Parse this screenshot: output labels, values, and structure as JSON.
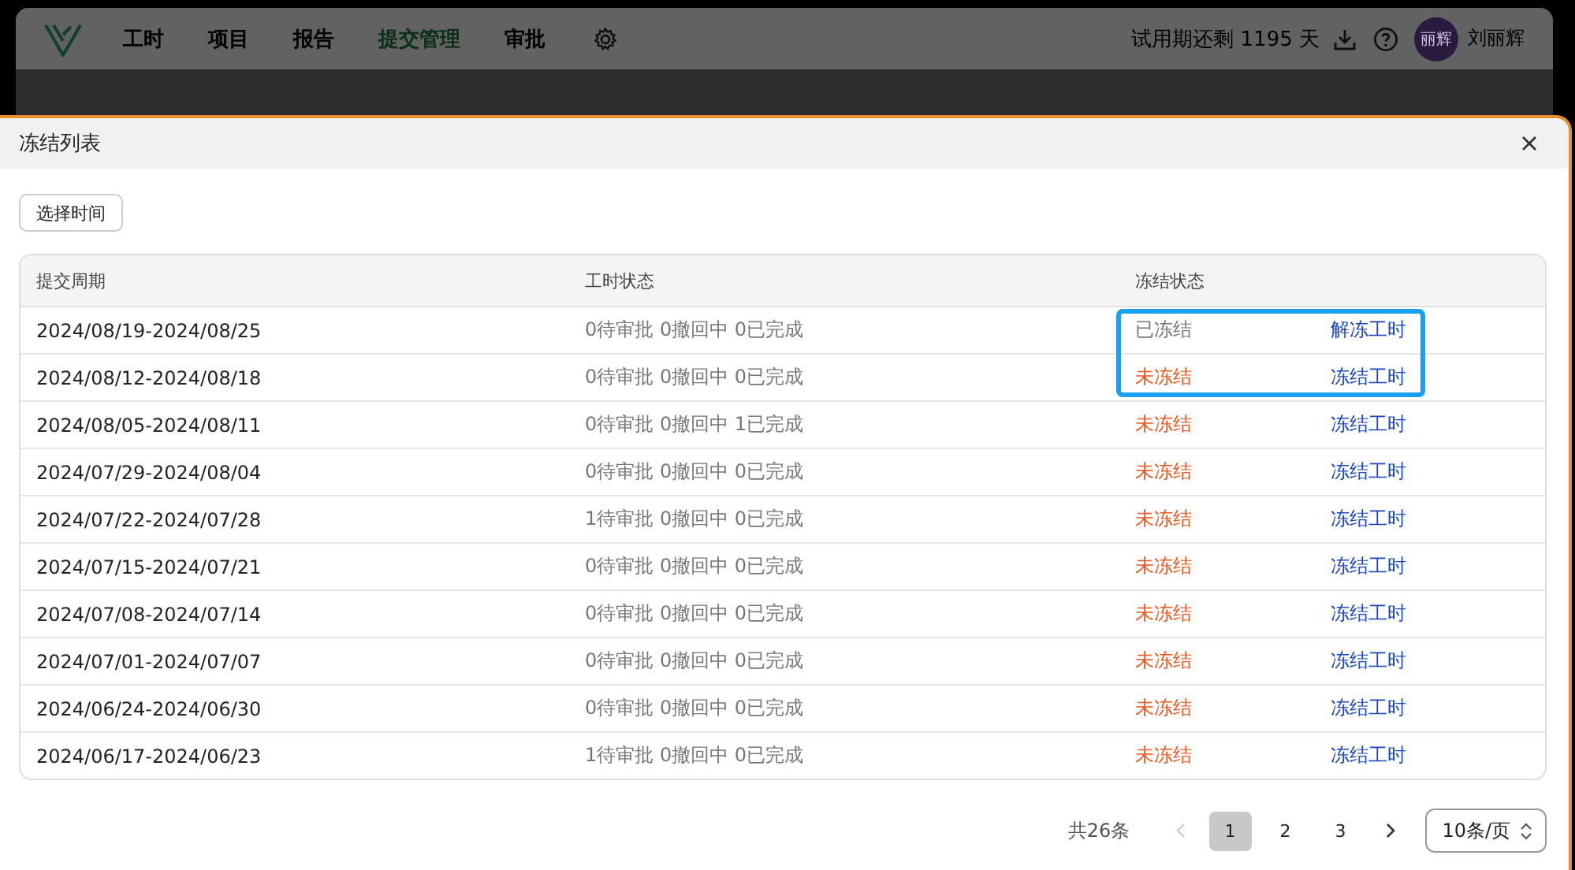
{
  "app": {
    "nav": [
      {
        "label": "工时",
        "selected": false
      },
      {
        "label": "项目",
        "selected": false
      },
      {
        "label": "报告",
        "selected": false
      },
      {
        "label": "提交管理",
        "selected": true
      },
      {
        "label": "审批",
        "selected": false
      }
    ],
    "trial": "试用期还剩 1195 天",
    "avatar": "丽辉",
    "user": "刘丽辉"
  },
  "dialog": {
    "title": "冻结列表",
    "pick_button": "选择时间",
    "columns": [
      "提交周期",
      "工时状态",
      "冻结状态"
    ],
    "rows": [
      {
        "period": "2024/08/19-2024/08/25",
        "status": "0待审批 0撤回中 0已完成",
        "frozen": true,
        "state": "已冻结",
        "action": "解冻工时",
        "highlighted": true
      },
      {
        "period": "2024/08/12-2024/08/18",
        "status": "0待审批 0撤回中 0已完成",
        "frozen": false,
        "state": "未冻结",
        "action": "冻结工时",
        "highlighted": true
      },
      {
        "period": "2024/08/05-2024/08/11",
        "status": "0待审批 0撤回中 1已完成",
        "frozen": false,
        "state": "未冻结",
        "action": "冻结工时",
        "highlighted": false
      },
      {
        "period": "2024/07/29-2024/08/04",
        "status": "0待审批 0撤回中 0已完成",
        "frozen": false,
        "state": "未冻结",
        "action": "冻结工时",
        "highlighted": false
      },
      {
        "period": "2024/07/22-2024/07/28",
        "status": "1待审批 0撤回中 0已完成",
        "frozen": false,
        "state": "未冻结",
        "action": "冻结工时",
        "highlighted": false
      },
      {
        "period": "2024/07/15-2024/07/21",
        "status": "0待审批 0撤回中 0已完成",
        "frozen": false,
        "state": "未冻结",
        "action": "冻结工时",
        "highlighted": false
      },
      {
        "period": "2024/07/08-2024/07/14",
        "status": "0待审批 0撤回中 0已完成",
        "frozen": false,
        "state": "未冻结",
        "action": "冻结工时",
        "highlighted": false
      },
      {
        "period": "2024/07/01-2024/07/07",
        "status": "0待审批 0撤回中 0已完成",
        "frozen": false,
        "state": "未冻结",
        "action": "冻结工时",
        "highlighted": false
      },
      {
        "period": "2024/06/24-2024/06/30",
        "status": "0待审批 0撤回中 0已完成",
        "frozen": false,
        "state": "未冻结",
        "action": "冻结工时",
        "highlighted": false
      },
      {
        "period": "2024/06/17-2024/06/23",
        "status": "1待审批 0撤回中 0已完成",
        "frozen": false,
        "state": "未冻结",
        "action": "冻结工时",
        "highlighted": false
      }
    ],
    "pagination": {
      "total": "共26条",
      "pages": [
        {
          "label": "1",
          "selected": true
        },
        {
          "label": "2",
          "selected": false
        },
        {
          "label": "3",
          "selected": false
        }
      ],
      "page_size": "10条/页"
    }
  }
}
